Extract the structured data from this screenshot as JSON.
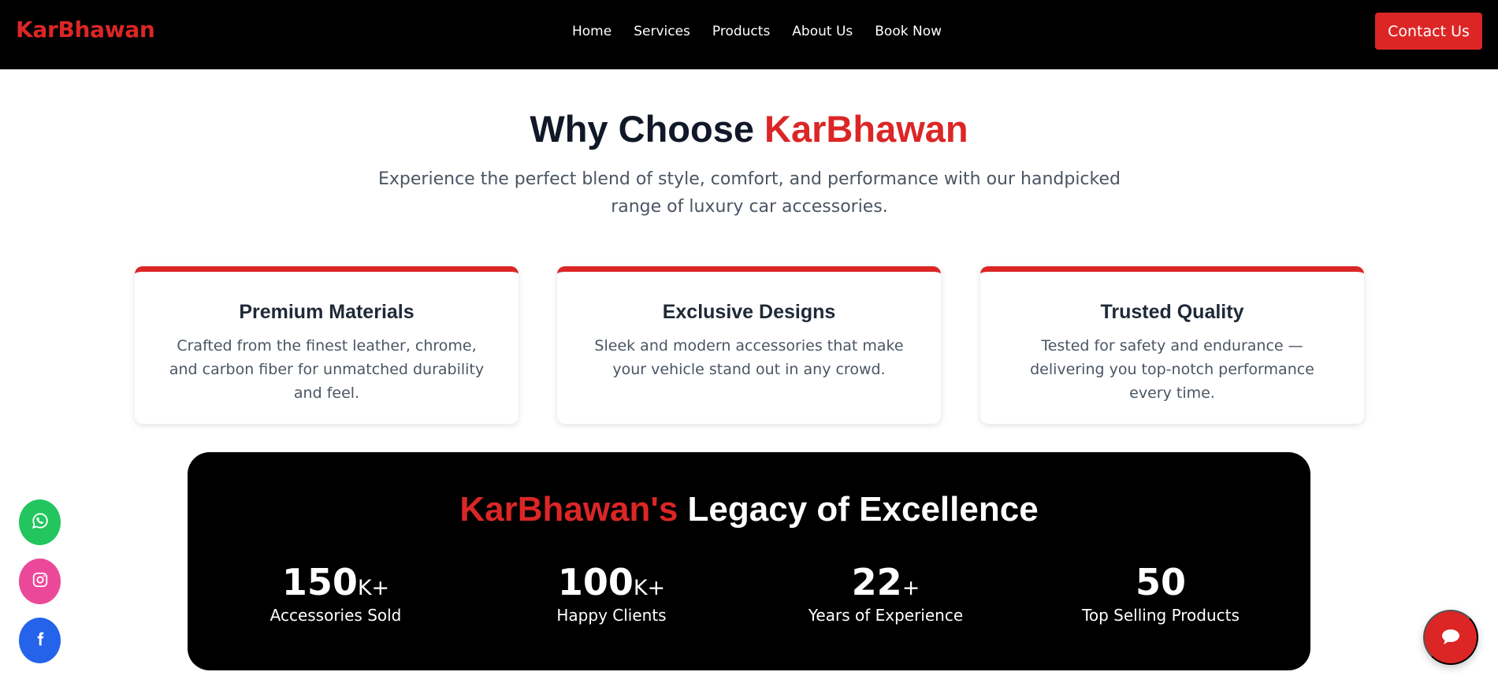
{
  "header": {
    "brand": "KarBhawan",
    "nav": [
      "Home",
      "Services",
      "Products",
      "About Us",
      "Book Now"
    ],
    "contact_label": "Contact Us"
  },
  "why": {
    "title_prefix": "Why Choose ",
    "title_accent": "KarBhawan",
    "subtitle": "Experience the perfect blend of style, comfort, and performance with our handpicked range of luxury car accessories.",
    "cards": [
      {
        "title": "Premium Materials",
        "text": "Crafted from the finest leather, chrome, and carbon fiber for unmatched durability and feel."
      },
      {
        "title": "Exclusive Designs",
        "text": "Sleek and modern accessories that make your vehicle stand out in any crowd."
      },
      {
        "title": "Trusted Quality",
        "text": "Tested for safety and endurance — delivering you top-notch performance every time."
      }
    ]
  },
  "stats": {
    "title_accent": "KarBhawan's",
    "title_rest": " Legacy of Excellence",
    "items": [
      {
        "value": "150",
        "suffix": "K+",
        "label": "Accessories Sold"
      },
      {
        "value": "100",
        "suffix": "K+",
        "label": "Happy Clients"
      },
      {
        "value": "22",
        "suffix": "+",
        "label": "Years of Experience"
      },
      {
        "value": "50",
        "suffix": "",
        "label": "Top Selling Products"
      }
    ]
  },
  "floating": {
    "social": [
      "whatsapp-icon",
      "instagram-icon",
      "facebook-icon"
    ],
    "chat": "chat-bubble-icon"
  },
  "colors": {
    "accent": "#dc2626",
    "whatsapp": "#22c55e",
    "instagram": "#ec4899",
    "facebook": "#2563eb"
  }
}
